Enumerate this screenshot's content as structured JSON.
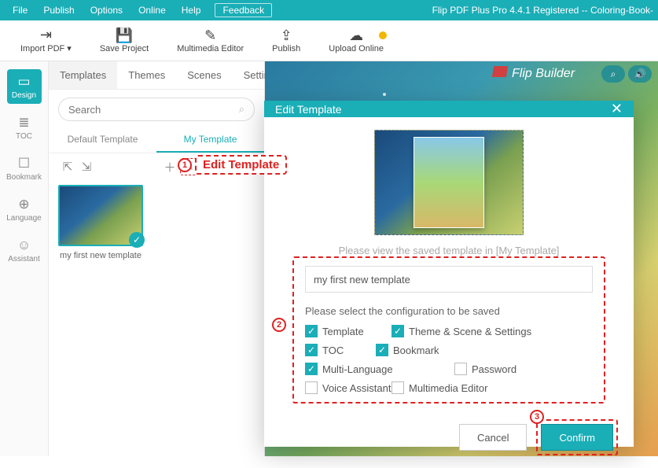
{
  "menubar": {
    "items": [
      "File",
      "Publish",
      "Options",
      "Online",
      "Help"
    ],
    "feedback": "Feedback",
    "title": "Flip PDF Plus Pro 4.4.1 Registered -- Coloring-Book-"
  },
  "toolbar": {
    "import": "Import PDF ▾",
    "save": "Save Project",
    "mme": "Multimedia Editor",
    "publish": "Publish",
    "upload": "Upload Online"
  },
  "leftnav": {
    "items": [
      {
        "label": "Design"
      },
      {
        "label": "TOC"
      },
      {
        "label": "Bookmark"
      },
      {
        "label": "Language"
      },
      {
        "label": "Assistant"
      }
    ]
  },
  "tabs": {
    "items": [
      "Templates",
      "Themes",
      "Scenes",
      "Settings"
    ]
  },
  "search": {
    "placeholder": "Search"
  },
  "subtabs": {
    "default": "Default Template",
    "my": "My Template"
  },
  "template_item": {
    "name": "my first new template"
  },
  "callout": {
    "n1": "1",
    "text": "Edit Template",
    "n2": "2",
    "n3": "3"
  },
  "preview": {
    "brand": "Flip Builder"
  },
  "modal": {
    "title": "Edit Template",
    "help": "Please view the saved template in [My Template]",
    "input_value": "my first new template",
    "cfg_label": "Please select the configuration to be saved",
    "checks": [
      {
        "label": "Template",
        "on": true,
        "w": "w1"
      },
      {
        "label": "Theme & Scene & Settings",
        "on": true,
        "w": "w2"
      },
      {
        "label": "TOC",
        "on": true,
        "w": "w3"
      },
      {
        "label": "Bookmark",
        "on": true,
        "w": "w1"
      },
      {
        "label": "Multi-Language",
        "on": true,
        "w": "w2"
      },
      {
        "label": "Password",
        "on": false,
        "w": "w3"
      },
      {
        "label": "Voice Assistant",
        "on": false,
        "w": "w1"
      },
      {
        "label": "Multimedia Editor",
        "on": false,
        "w": "w2"
      }
    ],
    "cancel": "Cancel",
    "confirm": "Confirm"
  }
}
